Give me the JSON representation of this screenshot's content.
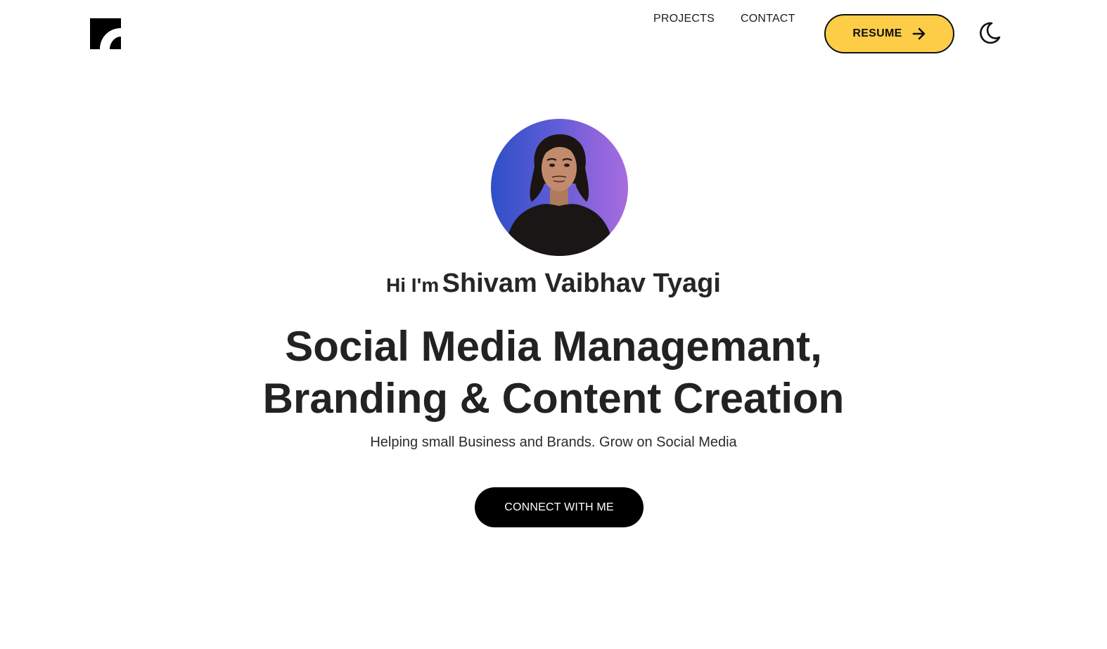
{
  "header": {
    "logo_icon": "brand-logo-icon",
    "nav": [
      {
        "label": "PROJECTS"
      },
      {
        "label": "CONTACT"
      }
    ],
    "resume_label": "RESUME",
    "resume_icon": "arrow-right-icon",
    "theme_icon": "moon-icon"
  },
  "hero": {
    "greeting_prefix": "Hi I'm",
    "name": "Shivam Vaibhav Tyagi",
    "headline_line1": "Social Media Managemant,",
    "headline_line2": "Branding & Content Creation",
    "subtitle": "Helping small Business and Brands. Grow on Social Media",
    "cta_label": "CONNECT WITH ME"
  },
  "colors": {
    "accent": "#fdcd48",
    "cta_background": "#000000",
    "text": "#222222",
    "avatar_gradient_start": "#2f4fc6",
    "avatar_gradient_end": "#a56ddf"
  }
}
